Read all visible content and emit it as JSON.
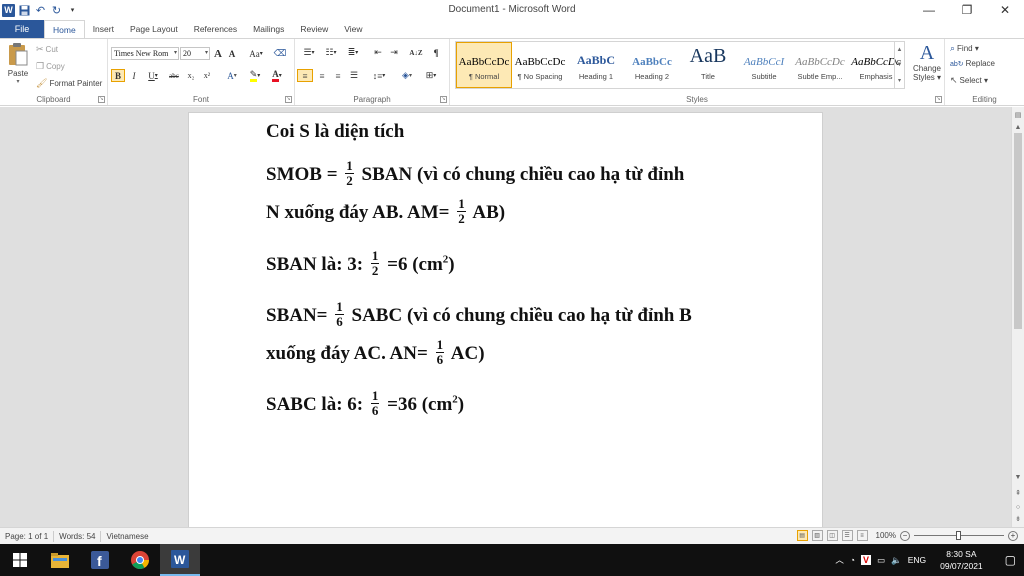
{
  "window": {
    "title": "Document1 - Microsoft Word",
    "controls": {
      "minimize": "—",
      "restore": "❐",
      "close": "✕"
    }
  },
  "quick_access": {
    "app_icon": "W",
    "save_icon": "save-icon",
    "undo_icon": "undo-icon",
    "redo_icon": "redo-icon"
  },
  "tabs": {
    "file": "File",
    "items": [
      "Home",
      "Insert",
      "Page Layout",
      "References",
      "Mailings",
      "Review",
      "View"
    ],
    "active": "Home"
  },
  "ribbon": {
    "clipboard": {
      "label": "Clipboard",
      "paste": "Paste",
      "cut": "Cut",
      "copy": "Copy",
      "format_painter": "Format Painter"
    },
    "font": {
      "label": "Font",
      "font_name": "Times New Rom",
      "font_size": "20",
      "grow": "A",
      "shrink": "A",
      "change_case": "Aa",
      "bold": "B",
      "italic": "I",
      "underline": "U",
      "strike": "abc",
      "subscript": "x₂",
      "superscript": "x²",
      "font_color_accent": "#e81123",
      "highlight_accent": "#ffff00"
    },
    "paragraph": {
      "label": "Paragraph",
      "sort": "A↓Z",
      "pilcrow": "¶"
    },
    "styles": {
      "label": "Styles",
      "items": [
        {
          "preview": "AaBbCcDc",
          "name": "¶ Normal"
        },
        {
          "preview": "AaBbCcDc",
          "name": "¶ No Spacing"
        },
        {
          "preview": "AaBbC",
          "name": "Heading 1"
        },
        {
          "preview": "AaBbCc",
          "name": "Heading 2"
        },
        {
          "preview": "AaB",
          "name": "Title"
        },
        {
          "preview": "AaBbCcI",
          "name": "Subtitle"
        },
        {
          "preview": "AaBbCcDc",
          "name": "Subtle Emp..."
        },
        {
          "preview": "AaBbCcDc",
          "name": "Emphasis"
        }
      ],
      "change_styles_1": "Change",
      "change_styles_2": "Styles ▾"
    },
    "editing": {
      "label": "Editing",
      "find": "Find ▾",
      "replace": "Replace",
      "select": "Select ▾"
    }
  },
  "document": {
    "line1": "Coi S là diện tích",
    "line2_a": "SMOB =",
    "line2_b": "SBAN (vì có chung chiều cao hạ từ đỉnh",
    "line3_a": "N xuống đáy AB. AM=",
    "line3_b": "AB)",
    "line4_a": "SBAN là: 3:",
    "line4_b": "=6 (cm",
    "line4_c": ")",
    "line5_a": "SBAN=",
    "line5_b": "SABC (vì có chung chiều cao hạ từ đỉnh B",
    "line6_a": "xuống đáy AC. AN=",
    "line6_b": "AC)",
    "line7_a": "SABC là: 6:",
    "line7_b": "=36 (cm",
    "line7_c": ")",
    "sup2": "2",
    "frac_half": {
      "num": "1",
      "den": "2"
    },
    "frac_sixth": {
      "num": "1",
      "den": "6"
    }
  },
  "statusbar": {
    "page": "Page: 1 of 1",
    "words": "Words: 54",
    "language": "Vietnamese",
    "zoom": "100%",
    "zoom_level": 1.0,
    "zoom_out": "−",
    "zoom_in": "+"
  },
  "taskbar": {
    "language": "ENG",
    "time": "8:30 SA",
    "date": "09/07/2021"
  },
  "colors": {
    "word_blue": "#2b579a",
    "taskbar": "#101010"
  }
}
